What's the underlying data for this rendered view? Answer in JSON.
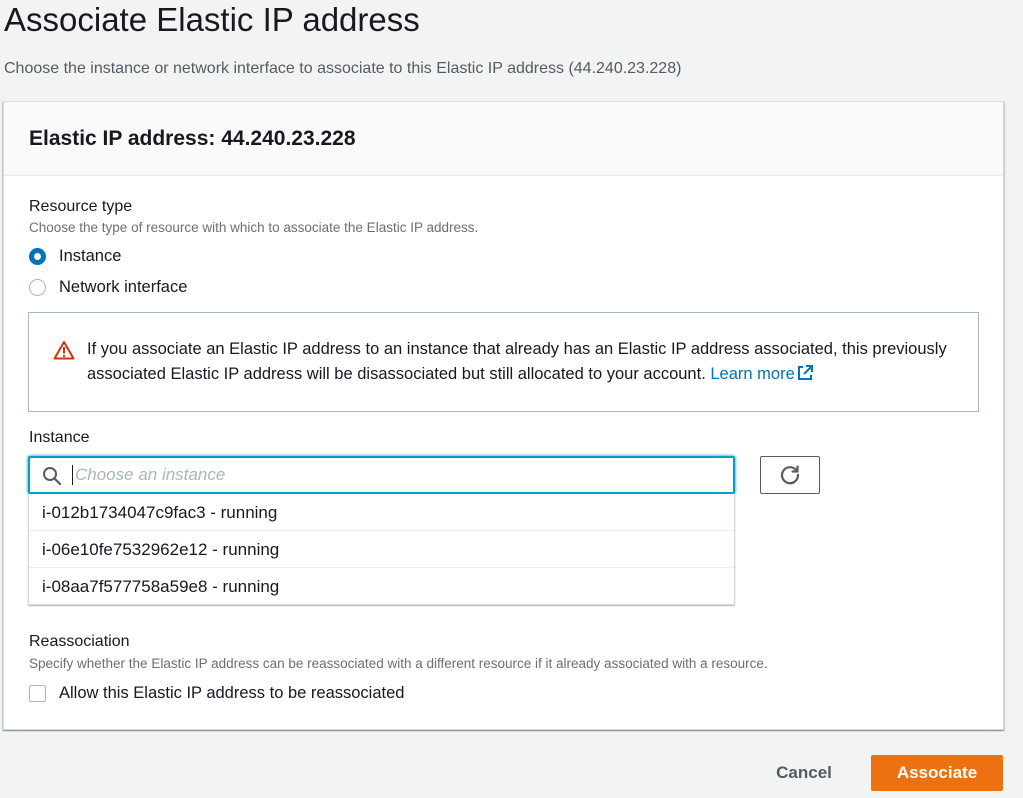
{
  "page": {
    "title": "Associate Elastic IP address",
    "subtitle": "Choose the instance or network interface to associate to this Elastic IP address (44.240.23.228)"
  },
  "panel": {
    "title": "Elastic IP address: 44.240.23.228",
    "resource_type": {
      "label": "Resource type",
      "description": "Choose the type of resource with which to associate the Elastic IP address.",
      "options": [
        {
          "label": "Instance",
          "selected": true
        },
        {
          "label": "Network interface",
          "selected": false
        }
      ]
    },
    "alert": {
      "text": "If you associate an Elastic IP address to an instance that already has an Elastic IP address associated, this previously associated Elastic IP address will be disassociated but still allocated to your account.",
      "link": "Learn more",
      "icon": "warning-icon",
      "color": "#d13212"
    },
    "instance": {
      "label": "Instance",
      "placeholder": "Choose an instance",
      "value": "",
      "options": [
        "i-012b1734047c9fac3 - running",
        "i-06e10fe7532962e12 - running",
        "i-08aa7f577758a59e8 - running"
      ]
    },
    "reassociation": {
      "label": "Reassociation",
      "description": "Specify whether the Elastic IP address can be reassociated with a different resource if it already associated with a resource.",
      "checkbox_label": "Allow this Elastic IP address to be reassociated",
      "checked": false
    }
  },
  "footer": {
    "cancel_label": "Cancel",
    "associate_label": "Associate"
  },
  "colors": {
    "accent": "#0073bb",
    "primary_button": "#ec7211",
    "focus": "#00a1c9"
  }
}
